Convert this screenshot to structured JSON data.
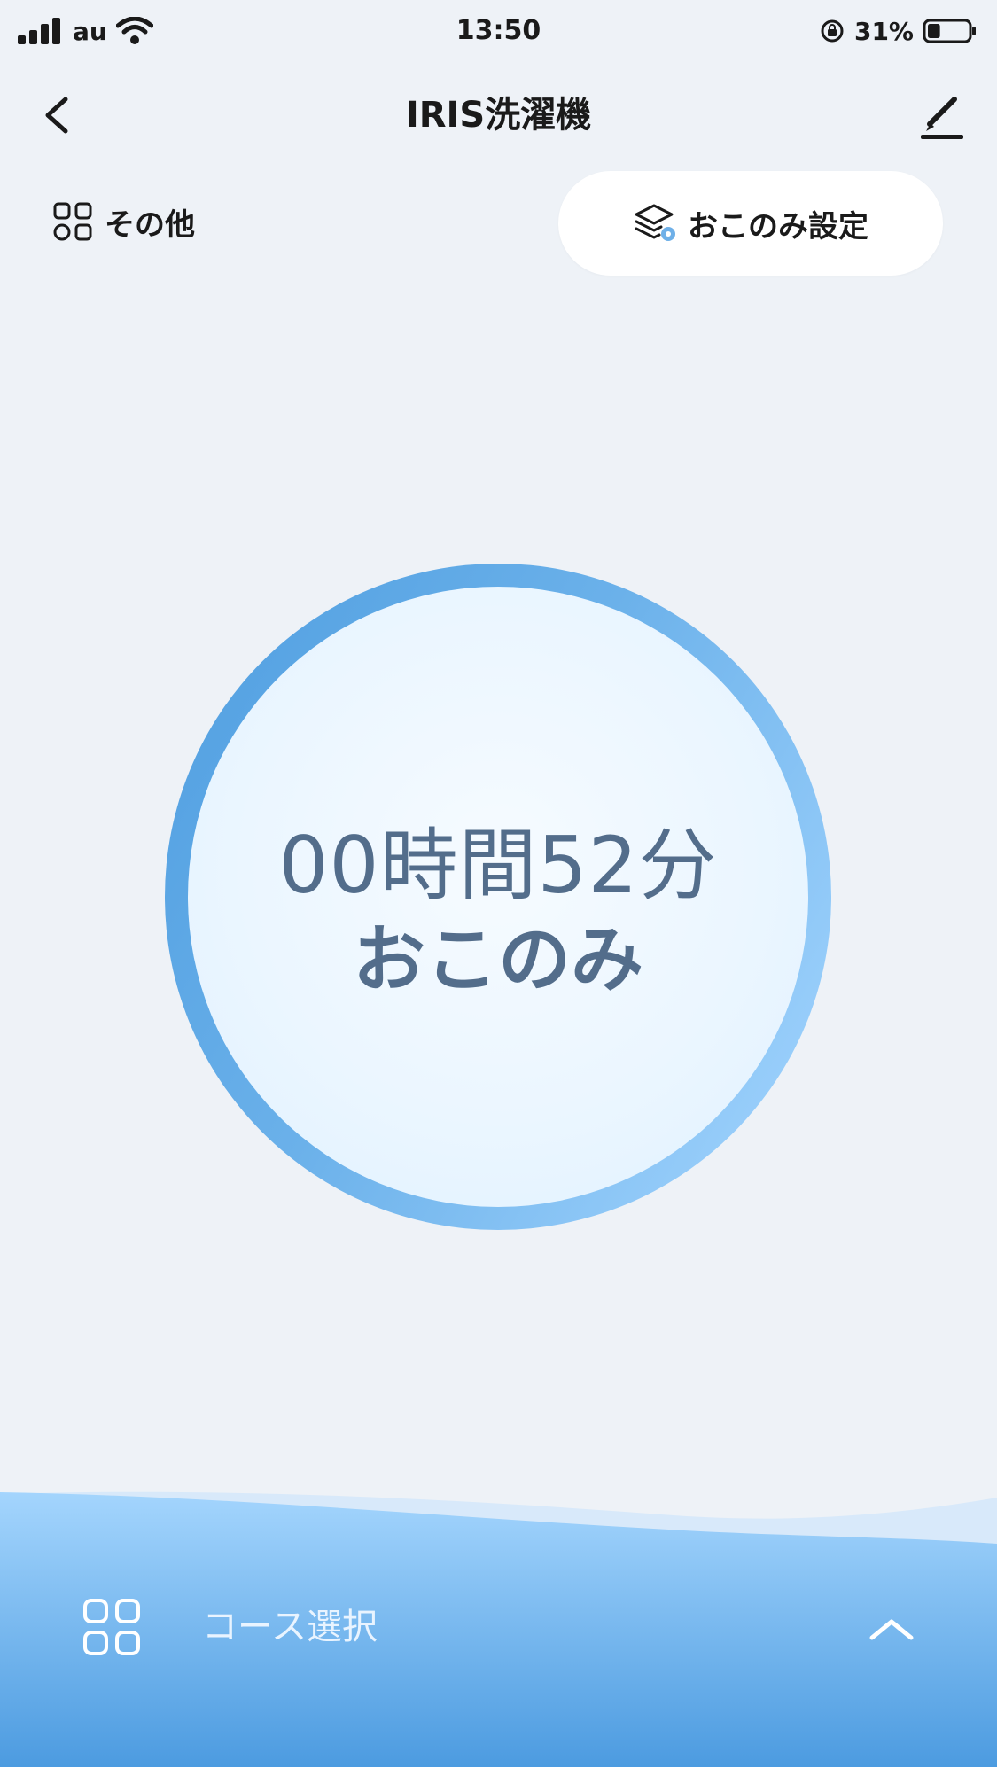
{
  "status_bar": {
    "carrier": "au",
    "time": "13:50",
    "battery_percent": "31%",
    "battery_level": 0.31,
    "icons": [
      "signal-icon",
      "wifi-icon",
      "rotation-lock-icon",
      "battery-icon"
    ]
  },
  "nav": {
    "title": "IRIS洗濯機",
    "icons": [
      "back-icon",
      "edit-icon"
    ]
  },
  "actions": {
    "other_label": "その他",
    "preference_label": "おこのみ設定",
    "icons": [
      "grid-icon",
      "layers-gear-icon"
    ]
  },
  "timer": {
    "time_text": "00時間52分",
    "mode_text": "おこのみ"
  },
  "bottom": {
    "course_label": "コース選択",
    "icons": [
      "grid-icon",
      "chevron-up-icon"
    ]
  },
  "colors": {
    "background": "#eef2f7",
    "ring_start": "#4f9ee0",
    "ring_end": "#a5d6ff",
    "timer_text": "#536d8b",
    "wave_top": "#9fd1fb",
    "wave_bottom": "#4a9be0"
  }
}
